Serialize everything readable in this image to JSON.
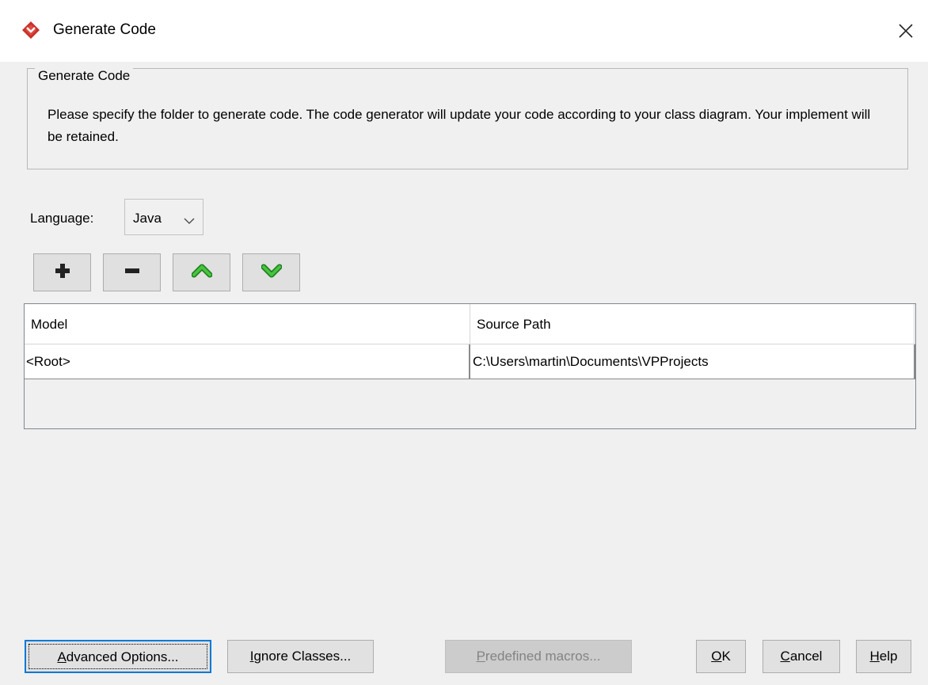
{
  "window": {
    "title": "Generate Code",
    "icon": "visual-paradigm-app-icon",
    "close_icon": "close-icon"
  },
  "group": {
    "legend": "Generate Code",
    "description": "Please specify the folder to generate code. The code generator will update your code according to your class diagram. Your implement will be retained."
  },
  "language": {
    "label": "Language:",
    "selected": "Java"
  },
  "toolbar": {
    "add_icon": "plus-icon",
    "remove_icon": "minus-icon",
    "move_up_icon": "chevron-up-icon",
    "move_down_icon": "chevron-down-icon"
  },
  "table": {
    "columns": [
      "Model",
      "Source Path"
    ],
    "rows": [
      [
        "<Root>",
        "C:\\Users\\martin\\Documents\\VPProjects"
      ]
    ]
  },
  "buttons": {
    "advanced_mn": "A",
    "advanced_rest": "dvanced Options...",
    "ignore_mn": "I",
    "ignore_rest": "gnore Classes...",
    "macros_mn": "P",
    "macros_rest": "redefined macros...",
    "ok_mn": "O",
    "ok_rest": "K",
    "cancel_mn": "C",
    "cancel_rest": "ancel",
    "help_mn": "H",
    "help_rest": "elp"
  },
  "colors": {
    "accent_red": "#d0312d",
    "arrow_green": "#3fb83a",
    "focus_blue": "#0078d7"
  }
}
